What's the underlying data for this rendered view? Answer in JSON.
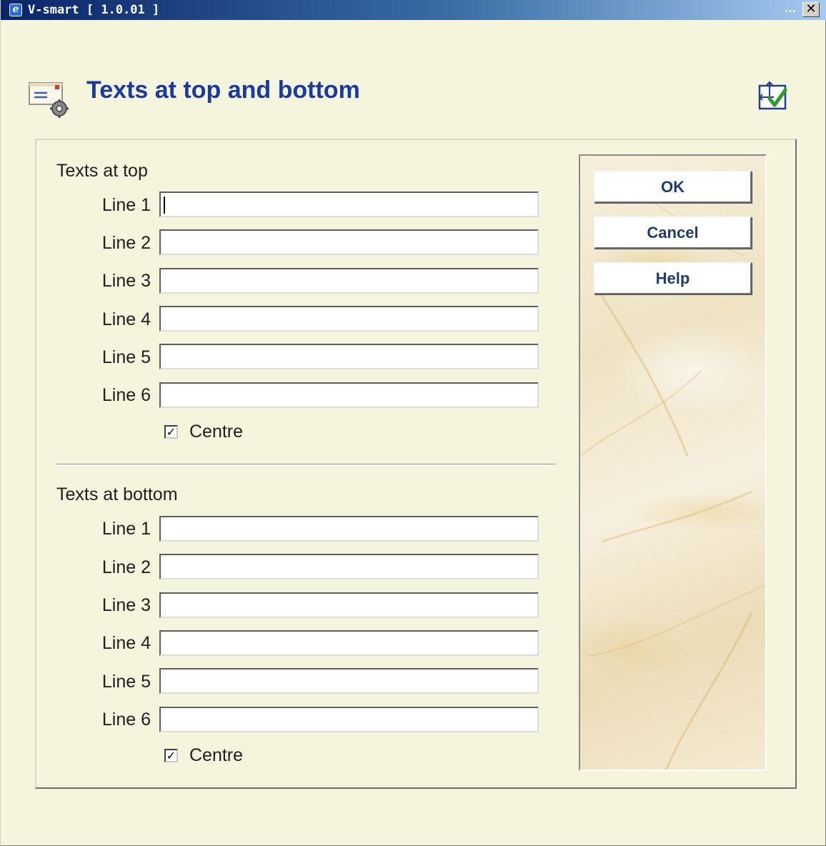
{
  "window": {
    "title": "V-smart [ 1.0.01 ]",
    "title_icon": "internet-explorer-icon",
    "minimize_glyph": "...",
    "close_glyph": "✕"
  },
  "header": {
    "title": "Texts at top and bottom",
    "icon": "letter-settings-icon",
    "action_icon": "resize-check-icon"
  },
  "top_section": {
    "label": "Texts at top",
    "lines": [
      {
        "label": "Line 1",
        "value": ""
      },
      {
        "label": "Line 2",
        "value": ""
      },
      {
        "label": "Line 3",
        "value": ""
      },
      {
        "label": "Line 4",
        "value": ""
      },
      {
        "label": "Line 5",
        "value": ""
      },
      {
        "label": "Line 6",
        "value": ""
      }
    ],
    "centre": {
      "label": "Centre",
      "checked": true,
      "mark": "✓"
    }
  },
  "bottom_section": {
    "label": "Texts at bottom",
    "lines": [
      {
        "label": "Line 1",
        "value": ""
      },
      {
        "label": "Line 2",
        "value": ""
      },
      {
        "label": "Line 3",
        "value": ""
      },
      {
        "label": "Line 4",
        "value": ""
      },
      {
        "label": "Line 5",
        "value": ""
      },
      {
        "label": "Line 6",
        "value": ""
      }
    ],
    "centre": {
      "label": "Centre",
      "checked": true,
      "mark": "✓"
    }
  },
  "buttons": {
    "ok": "OK",
    "cancel": "Cancel",
    "help": "Help"
  },
  "colors": {
    "window_bg": "#f5f4dc",
    "title_bar": "#0a246a",
    "title_text": "#1a3a9c",
    "button_text": "#1e3d6e"
  }
}
